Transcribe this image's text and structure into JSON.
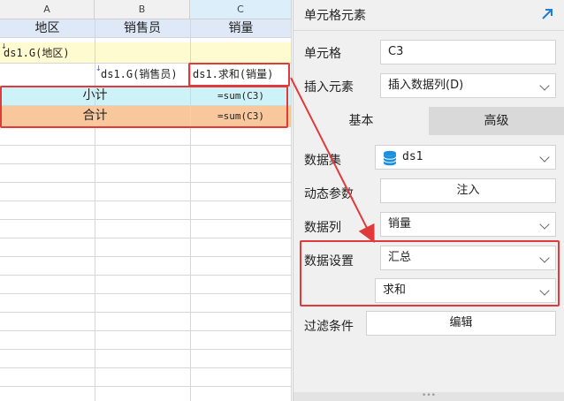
{
  "sheet": {
    "columns": [
      "A",
      "B",
      "C"
    ],
    "header_row": [
      "地区",
      "销售员",
      "销量"
    ],
    "row_region": "ds1.G(地区)",
    "row_data": {
      "b": "ds1.G(销售员)",
      "c": "ds1.求和(销量)"
    },
    "subtotal": {
      "label": "小计",
      "formula": "=sum(C3)"
    },
    "total": {
      "label": "合计",
      "formula": "=sum(C3)"
    }
  },
  "panel": {
    "title": "单元格元素",
    "expand_icon": "diagonal-arrow-icon",
    "cell_label": "单元格",
    "cell_value": "C3",
    "insert_label": "插入元素",
    "insert_value": "插入数据列(D)",
    "tabs": {
      "basic": "基本",
      "advanced": "高级"
    },
    "dataset_label": "数据集",
    "dataset_value": "ds1",
    "dynamic_label": "动态参数",
    "dynamic_button": "注入",
    "column_label": "数据列",
    "column_value": "销量",
    "setting_label": "数据设置",
    "setting_value": "汇总",
    "setting_sub_value": "求和",
    "filter_label": "过滤条件",
    "filter_button": "编辑",
    "resize_handle": "•••"
  },
  "colors": {
    "highlight_red": "#e03a3a",
    "header_blue": "#dfe8f6",
    "yellow_row": "#fffbd0",
    "cyan_row": "#cdf3f8",
    "orange_row": "#f9c79c",
    "accent_blue": "#1a7fd8"
  }
}
